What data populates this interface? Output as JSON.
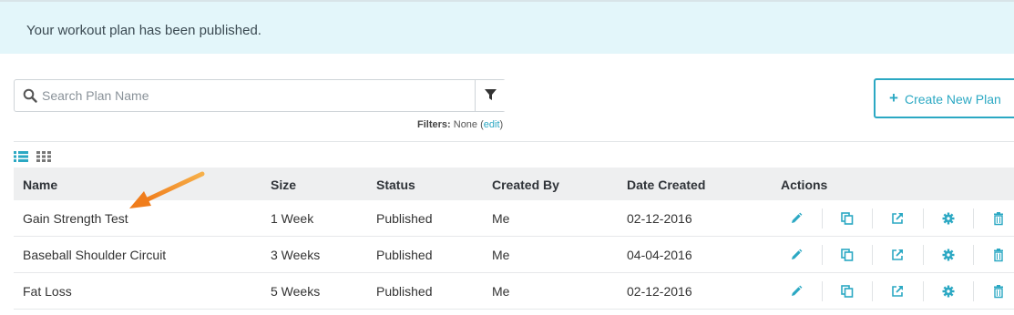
{
  "alert": {
    "message": "Your workout plan has been published."
  },
  "search": {
    "placeholder": "Search Plan Name",
    "value": ""
  },
  "filters": {
    "label": "Filters:",
    "value": "None",
    "open_paren": "(",
    "edit_label": "edit",
    "close_paren": ")"
  },
  "create_button": {
    "label": "Create New Plan",
    "plus": "+"
  },
  "colors": {
    "accent": "#2ba8c3",
    "alert_bg": "#e3f6fa",
    "header_bg": "#eeeff0",
    "arrow": "#f0912b"
  },
  "table": {
    "columns": {
      "name": "Name",
      "size": "Size",
      "status": "Status",
      "created_by": "Created By",
      "date_created": "Date Created",
      "actions": "Actions"
    },
    "rows": [
      {
        "name": "Gain Strength Test",
        "size": "1 Week",
        "status": "Published",
        "created_by": "Me",
        "date_created": "02-12-2016"
      },
      {
        "name": "Baseball Shoulder Circuit",
        "size": "3 Weeks",
        "status": "Published",
        "created_by": "Me",
        "date_created": "04-04-2016"
      },
      {
        "name": "Fat Loss",
        "size": "5 Weeks",
        "status": "Published",
        "created_by": "Me",
        "date_created": "02-12-2016"
      }
    ],
    "row_actions": [
      "pencil-icon",
      "copy-icon",
      "external-link-icon",
      "gear-icon",
      "trash-icon"
    ]
  }
}
